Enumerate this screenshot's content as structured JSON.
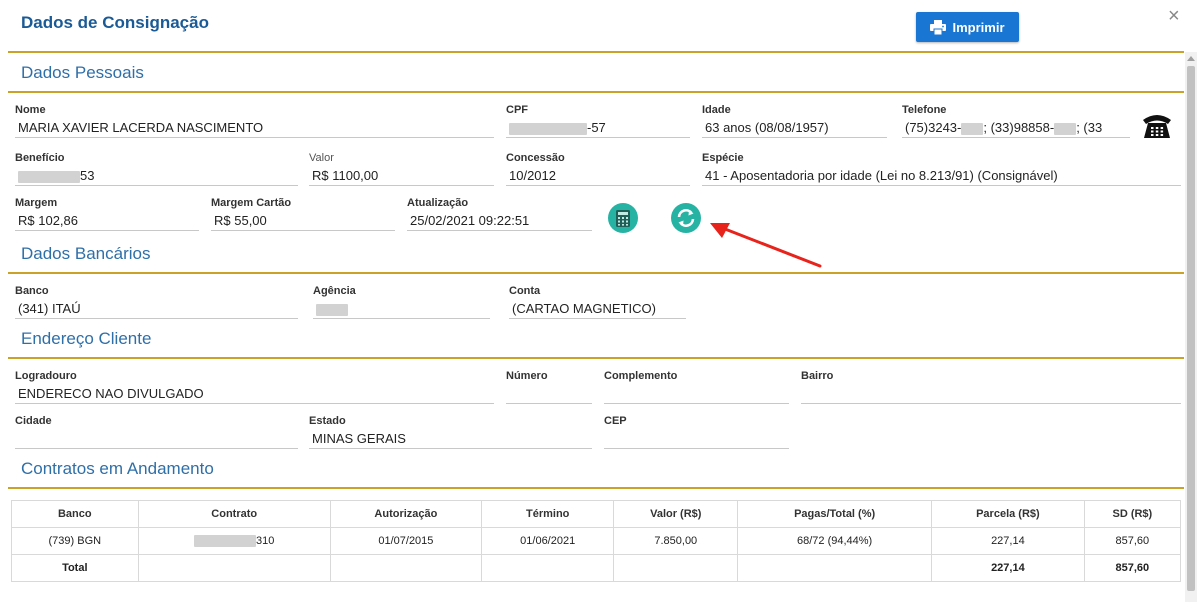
{
  "modal": {
    "title": "Dados de Consignação",
    "print_label": "Imprimir",
    "close": "×"
  },
  "sections": {
    "personal": "Dados Pessoais",
    "bank": "Dados Bancários",
    "address": "Endereço Cliente",
    "contracts": "Contratos em Andamento"
  },
  "personal": {
    "nome_label": "Nome",
    "nome": "MARIA XAVIER LACERDA NASCIMENTO",
    "cpf_label": "CPF",
    "cpf_suffix": "-57",
    "idade_label": "Idade",
    "idade": "63 anos (08/08/1957)",
    "telefone_label": "Telefone",
    "tel_part1": "(75)3243-",
    "tel_part2": "; (33)98858-",
    "tel_part3": "; (33",
    "beneficio_label": "Benefício",
    "beneficio_suffix": "53",
    "valor_label": "Valor",
    "valor": "R$ 1100,00",
    "concessao_label": "Concessão",
    "concessao": "10/2012",
    "especie_label": "Espécie",
    "especie": "41 - Aposentadoria por idade (Lei no 8.213/91) (Consignável)",
    "margem_label": "Margem",
    "margem": "R$ 102,86",
    "margem_cartao_label": "Margem Cartão",
    "margem_cartao": "R$ 55,00",
    "atualizacao_label": "Atualização",
    "atualizacao": "25/02/2021 09:22:51"
  },
  "bank": {
    "banco_label": "Banco",
    "banco": "(341) ITAÚ",
    "agencia_label": "Agência",
    "conta_label": "Conta",
    "conta": "(CARTAO MAGNETICO)"
  },
  "address": {
    "logradouro_label": "Logradouro",
    "logradouro": "ENDERECO NAO DIVULGADO",
    "numero_label": "Número",
    "numero": "",
    "complemento_label": "Complemento",
    "complemento": "",
    "bairro_label": "Bairro",
    "bairro": "",
    "cidade_label": "Cidade",
    "cidade": "",
    "estado_label": "Estado",
    "estado": "MINAS GERAIS",
    "cep_label": "CEP",
    "cep": ""
  },
  "contracts": {
    "headers": [
      "Banco",
      "Contrato",
      "Autorização",
      "Término",
      "Valor (R$)",
      "Pagas/Total (%)",
      "Parcela (R$)",
      "SD (R$)"
    ],
    "rows": [
      {
        "banco": "(739) BGN",
        "contrato_suffix": "310",
        "autorizacao": "01/07/2015",
        "termino": "01/06/2021",
        "valor": "7.850,00",
        "pagas": "68/72 (94,44%)",
        "parcela": "227,14",
        "sd": "857,60"
      }
    ],
    "total": {
      "label": "Total",
      "parcela": "227,14",
      "sd": "857,60"
    }
  },
  "icons": {
    "print": "printer-icon",
    "calculator": "calculator-icon",
    "refresh": "refresh-icon",
    "phone": "telephone-icon",
    "annotation": "red-arrow"
  },
  "colors": {
    "accent": "#1976d2",
    "section_title": "#2f6fa8",
    "divider": "#c9a227",
    "icon_teal": "#26b3a4",
    "arrow": "#e8231c"
  }
}
